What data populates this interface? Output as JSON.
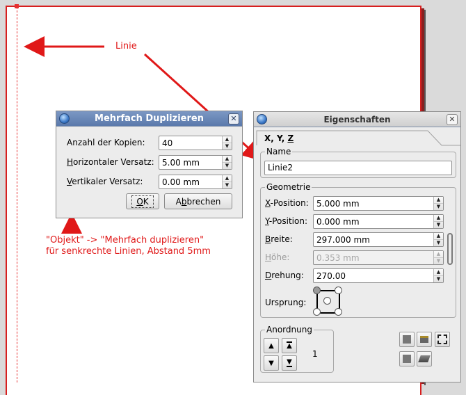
{
  "canvas": {
    "annotations": {
      "linie": "Linie",
      "hint_line1": "\"Objekt\" -> \"Mehrfach duplizieren\"",
      "hint_line2": "für senkrechte Linien, Abstand 5mm"
    },
    "colors": {
      "annotation": "#e01818",
      "page_border": "#d71f1f"
    }
  },
  "duplicate_dialog": {
    "title": "Mehrfach Duplizieren",
    "icons": {
      "app": "scribus-globe-icon",
      "close": "close-icon"
    },
    "close_glyph": "✕",
    "fields": [
      {
        "label_pre": "",
        "label_u": "",
        "label_rest": "Anzahl der Kopien:",
        "value": "40"
      },
      {
        "label_pre": "",
        "label_u": "H",
        "label_rest": "orizontaler Versatz:",
        "value": "5.00 mm"
      },
      {
        "label_pre": "",
        "label_u": "V",
        "label_rest": "ertikaler Versatz:",
        "value": "0.00 mm"
      }
    ],
    "ok": {
      "u": "O",
      "rest": "K"
    },
    "cancel": {
      "pre": "A",
      "u": "b",
      "rest": "brechen"
    }
  },
  "properties": {
    "title": "Eigenschaften",
    "close_glyph": "✕",
    "tab": {
      "pre": "X, Y, ",
      "u": "Z"
    },
    "name_group": {
      "title": "Name",
      "value": "Linie2"
    },
    "geometry": {
      "title": "Geometrie",
      "fields": [
        {
          "u": "X",
          "rest": "-Position:",
          "value": "5.000 mm",
          "disabled": false
        },
        {
          "u": "Y",
          "rest": "-Position:",
          "value": "0.000 mm",
          "disabled": false
        },
        {
          "u": "B",
          "rest": "reite:",
          "value": "297.000 mm",
          "disabled": false
        },
        {
          "u": "H",
          "rest": "öhe:",
          "value": "0.353 mm",
          "disabled": true
        },
        {
          "u": "D",
          "rest": "rehung:",
          "value": "270.00",
          "disabled": false
        }
      ],
      "origin_label": "Ursprung:"
    },
    "arrangement": {
      "title": "Anordnung",
      "level": "1",
      "icons": [
        "raise-icon",
        "raise-to-top-icon",
        "lower-icon",
        "lower-to-bottom-icon"
      ]
    },
    "side_icons": [
      "no-print-icon",
      "lock-icon",
      "size-lock-icon",
      "flip-icon",
      "flip-vertical-icon"
    ]
  }
}
